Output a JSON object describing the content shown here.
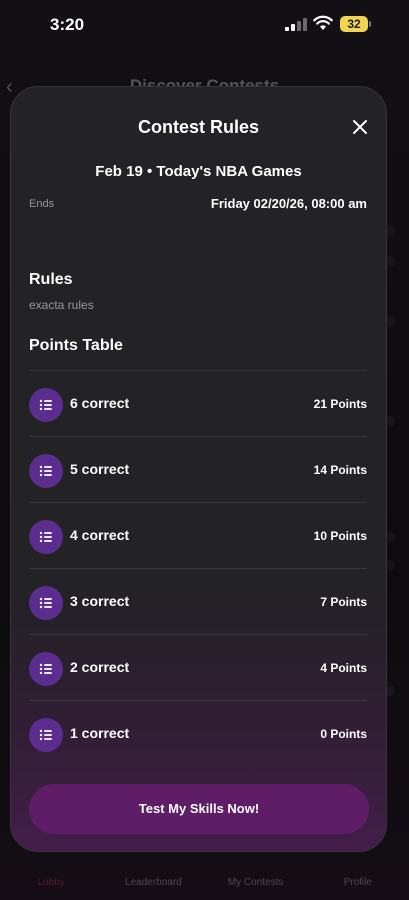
{
  "status_bar": {
    "time": "3:20",
    "battery": "32"
  },
  "background": {
    "title": "Discover Contests",
    "tabs": [
      "Lobby",
      "Leaderboard",
      "My Contests",
      "Profile"
    ]
  },
  "modal": {
    "title": "Contest Rules",
    "subtitle": "Feb 19 • Today's NBA Games",
    "ends_label": "Ends",
    "ends_value": "Friday 02/20/26, 08:00 am",
    "rules_heading": "Rules",
    "rules_text": "exacta rules",
    "points_heading": "Points Table",
    "points_table": [
      {
        "label": "6 correct",
        "points": "21 Points"
      },
      {
        "label": "5 correct",
        "points": "14 Points"
      },
      {
        "label": "4 correct",
        "points": "10 Points"
      },
      {
        "label": "3 correct",
        "points": "7 Points"
      },
      {
        "label": "2 correct",
        "points": "4 Points"
      },
      {
        "label": "1 correct",
        "points": "0 Points"
      }
    ],
    "cta_label": "Test My Skills Now!"
  },
  "colors": {
    "accent_purple": "#5b2d8f",
    "cta_background": "#5f1c67",
    "modal_background": "#232225",
    "battery_yellow": "#f1d54a"
  },
  "icons": {
    "close": "close-icon",
    "row": "list-icon",
    "back": "chevron-left-icon"
  }
}
